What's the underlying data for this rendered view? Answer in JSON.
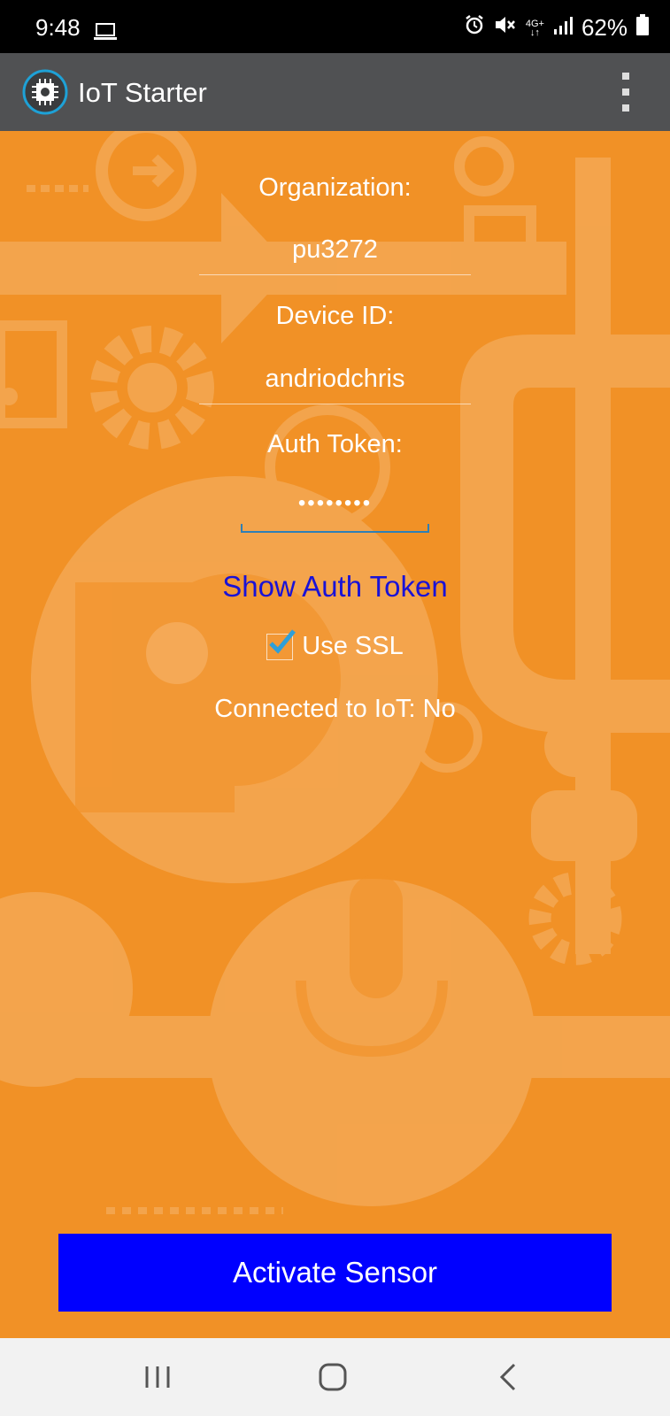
{
  "status_bar": {
    "time": "9:48",
    "network_label": "4G+",
    "battery": "62%"
  },
  "app_bar": {
    "title": "IoT Starter",
    "icon": "chip-icon",
    "menu_icon": "overflow-menu-icon"
  },
  "form": {
    "organization_label": "Organization:",
    "organization_value": "pu3272",
    "device_id_label": "Device ID:",
    "device_id_value": "andriodchris",
    "auth_token_label": "Auth Token:",
    "auth_token_value": "••••••••",
    "show_token_link": "Show Auth Token",
    "use_ssl_label": "Use SSL",
    "use_ssl_checked": true,
    "connection_status": "Connected to IoT: No"
  },
  "activate_button": "Activate Sensor",
  "colors": {
    "background": "#f19126",
    "app_bar": "#505153",
    "button": "#0000ff",
    "link": "#1a12d6",
    "focus_underline": "#2f7fb5"
  },
  "nav_bar": {
    "recents_icon": "recents-icon",
    "home_icon": "home-icon",
    "back_icon": "back-icon"
  }
}
